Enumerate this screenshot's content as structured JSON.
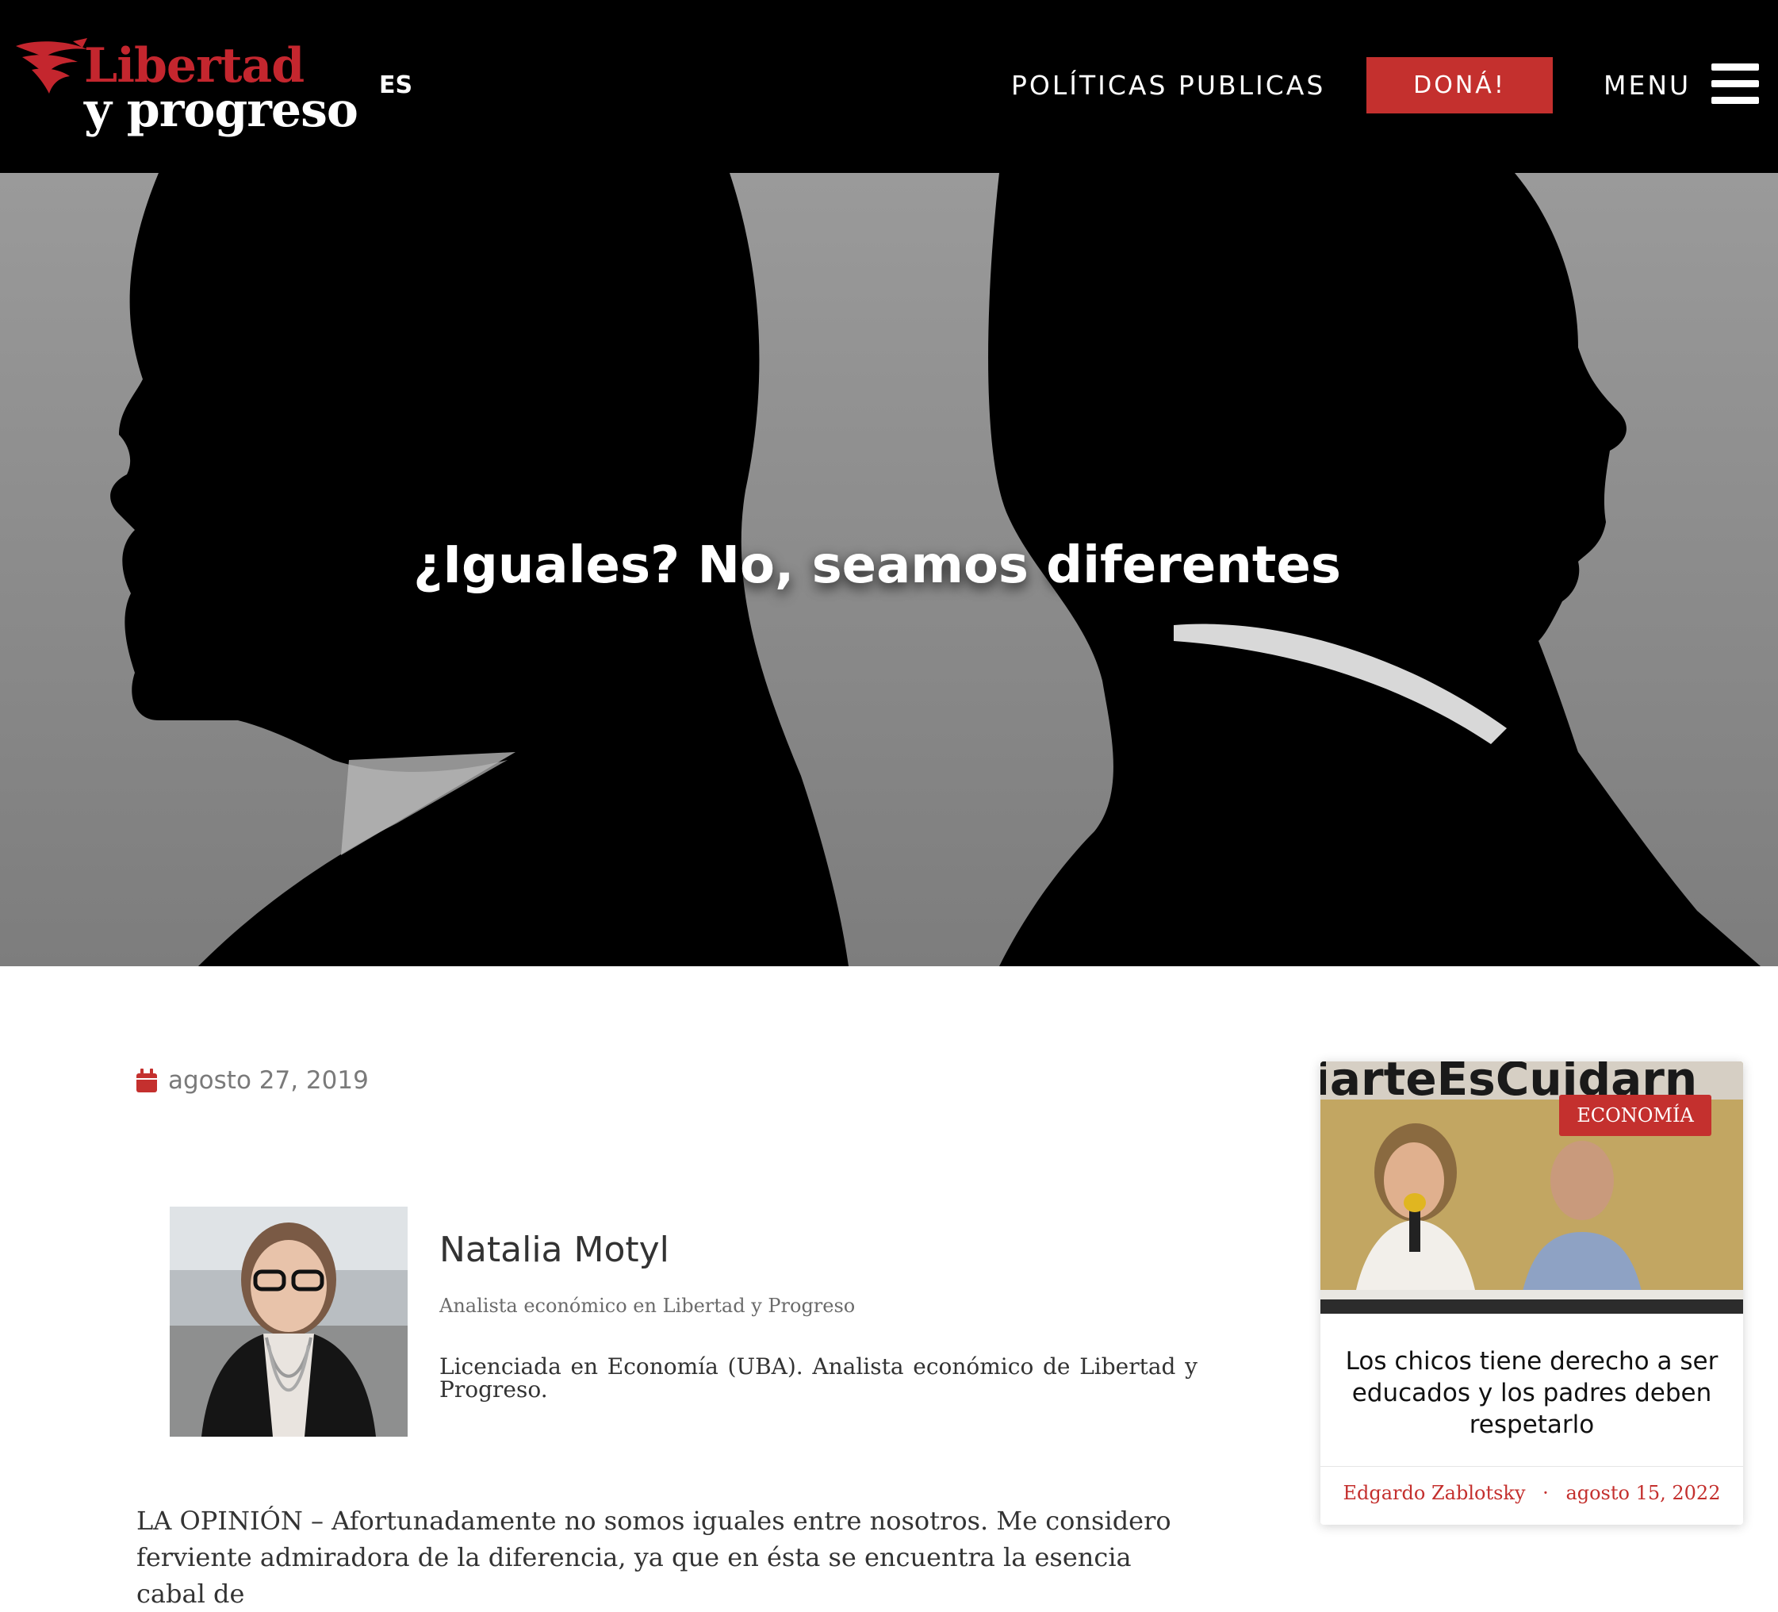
{
  "header": {
    "logo_line1": "Libertad",
    "logo_line2": "y progreso",
    "language": "ES",
    "nav_link": "POLÍTICAS PUBLICAS",
    "donate_label": "DONÁ!",
    "menu_label": "MENU",
    "menu_icon": "hamburger-icon"
  },
  "hero": {
    "title": "¿Iguales? No, seamos diferentes"
  },
  "article": {
    "calendar_icon": "calendar-icon",
    "date": "agosto 27, 2019",
    "author": {
      "name": "Natalia Motyl",
      "role": "Analista económico en Libertad y Progreso",
      "bio": "Licenciada en Economía (UBA). Analista económico de Libertad y Progreso."
    },
    "body": "LA OPINIÓN – Afortunadamente no somos iguales entre nosotros. Me considero ferviente admiradora de la diferencia, ya que en ésta se encuentra la esencia cabal de"
  },
  "sidebar_card": {
    "banner_text": "iarteEsCuidarn",
    "category": "ECONOMÍA",
    "title": "Los chicos tiene derecho a ser educados y los padres deben respetarlo",
    "author": "Edgardo Zablotsky",
    "separator": "·",
    "date": "agosto 15, 2022"
  },
  "colors": {
    "brand_red": "#c4302e",
    "header_bg": "#000000",
    "meta_gray": "#7a7a7a"
  }
}
